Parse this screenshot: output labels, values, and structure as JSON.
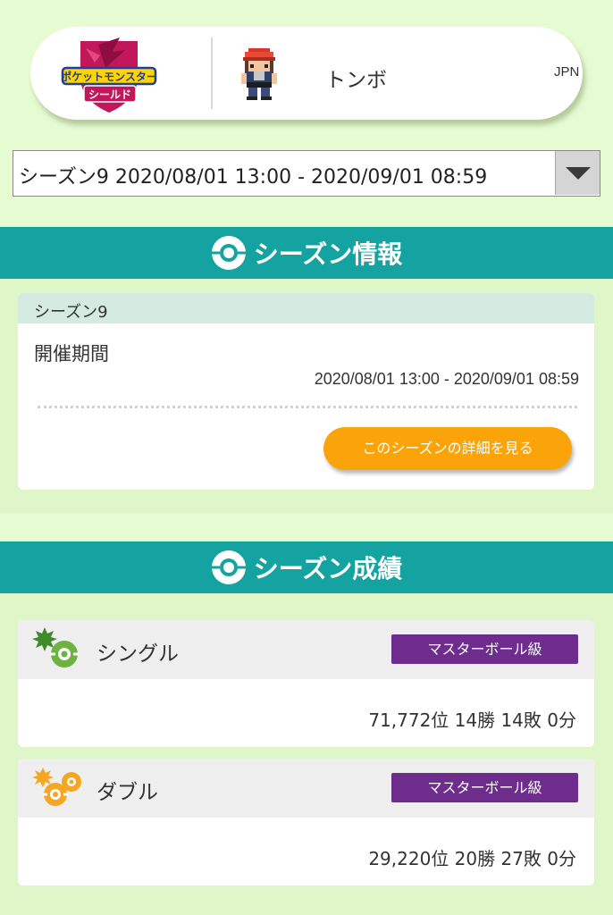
{
  "profile": {
    "logo_icon": "pokemon-shield-logo",
    "logo_text_top": "ポケットモンスター",
    "logo_text_bottom": "シールド",
    "avatar_icon": "trainer-sprite",
    "name": "トンボ",
    "country": "JPN"
  },
  "season_select": {
    "selected": "シーズン9 2020/08/01 13:00 - 2020/09/01 08:59",
    "arrow_icon": "dropdown-arrow"
  },
  "season_info": {
    "header_title": "シーズン情報",
    "header_icon": "monster-ball-icon",
    "card_title": "シーズン9",
    "period_label": "開催期間",
    "period_value": "2020/08/01 13:00 - 2020/09/01 08:59",
    "detail_button": "このシーズンの詳細を見る"
  },
  "season_results": {
    "header_title": "シーズン成績",
    "header_icon": "monster-ball-icon",
    "rows": [
      {
        "label": "シングル",
        "icon": "single-battle-icon",
        "rank": "マスターボール級",
        "record": "71,772位 14勝 14敗 0分"
      },
      {
        "label": "ダブル",
        "icon": "double-battle-icon",
        "rank": "マスターボール級",
        "record": "29,220位 20勝 27敗 0分"
      }
    ]
  },
  "colors": {
    "background": "#e6fbd2",
    "header_teal": "#14a3a0",
    "button_orange": "#fba40a",
    "rank_purple": "#6e2c8d",
    "single_green": "#6db33f",
    "double_orange": "#f6a623",
    "shield_magenta": "#c2185b"
  }
}
